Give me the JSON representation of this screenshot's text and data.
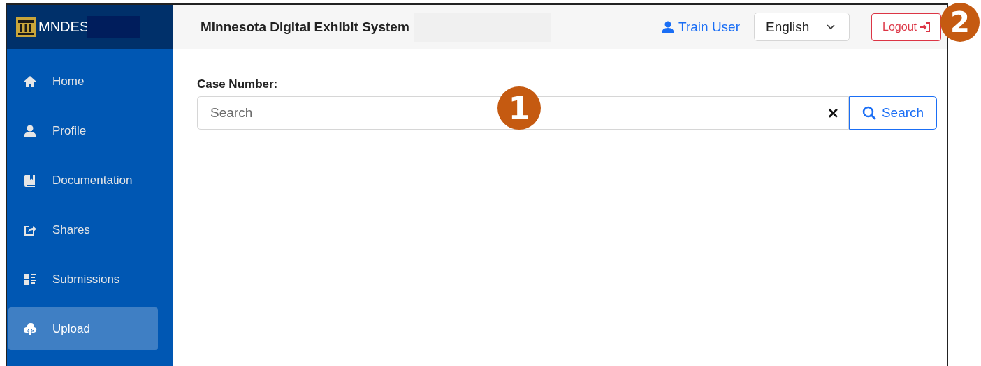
{
  "brand": {
    "name": "MNDES"
  },
  "header": {
    "title": "Minnesota Digital Exhibit System",
    "user": "Train User",
    "language": "English",
    "logout": "Logout"
  },
  "sidebar": {
    "items": [
      {
        "label": "Home",
        "kind": "home",
        "selected": false
      },
      {
        "label": "Profile",
        "kind": "user",
        "selected": false
      },
      {
        "label": "Documentation",
        "kind": "book",
        "selected": false
      },
      {
        "label": "Shares",
        "kind": "share",
        "selected": false
      },
      {
        "label": "Submissions",
        "kind": "list",
        "selected": false
      },
      {
        "label": "Upload",
        "kind": "upload",
        "selected": true
      }
    ]
  },
  "search": {
    "label": "Case Number:",
    "placeholder": "Search",
    "clear": "×",
    "button": "Search"
  },
  "callouts": [
    "1",
    "2"
  ]
}
